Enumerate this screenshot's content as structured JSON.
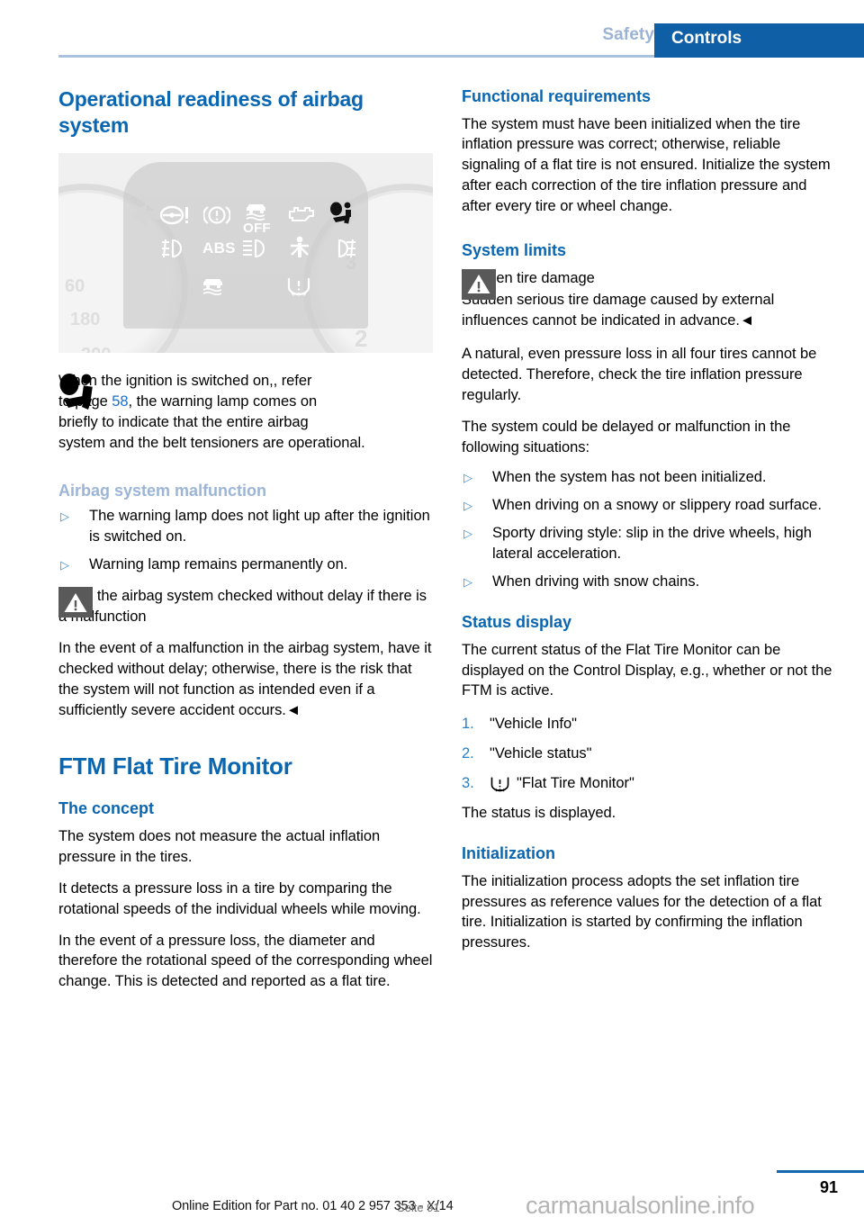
{
  "header": {
    "tab_inactive": "Safety",
    "tab_active": "Controls",
    "accent_blue": "#0f5fa6",
    "muted_blue": "#9bb3d4"
  },
  "figure": {
    "name": "instrument-cluster-warning-lamps",
    "gauge_numbers": [
      "60",
      "180",
      "200",
      "2",
      "3"
    ],
    "tell_tales": [
      "steering-warning-icon",
      "brake-warning-icon",
      "dsc-off-icon",
      "check-engine-icon",
      "airbag-warning-icon",
      "fog-lamp-icon",
      "abs-icon",
      "low-beam-icon",
      "seatbelt-icon",
      "high-beam-icon",
      "dsc-icon",
      "tire-pressure-icon"
    ],
    "dsc_off_label": "OFF",
    "abs_label": "ABS"
  },
  "left_column": {
    "title": "Operational readiness of airbag system",
    "hint": {
      "icon": "airbag-person-icon",
      "line1": "When the ignition is switched on,, refer",
      "line2_pre": "to page ",
      "page_ref": "58",
      "line2_post": ", the warning lamp comes on",
      "line3": "briefly to indicate that the entire airbag",
      "line4": "system and the belt tensioners are operational."
    },
    "malfunction_heading": "Airbag system malfunction",
    "malfunction_bullets": [
      "The warning lamp does not light up after the ignition is switched on.",
      "Warning lamp remains permanently on."
    ],
    "warning": {
      "icon": "warning-triangle-icon",
      "text": "Have the airbag system checked without delay if there is a malfunction",
      "body": "In the event of a malfunction in the airbag system, have it checked without delay; otherwise, there is the risk that the system will not function as intended even if a sufficiently severe accident occurs.◄"
    },
    "ftm_title": "FTM Flat Tire Monitor",
    "concept_heading": "The concept",
    "concept_paragraphs": [
      "The system does not measure the actual inflation pressure in the tires.",
      "It detects a pressure loss in a tire by comparing the rotational speeds of the individual wheels while moving.",
      "In the event of a pressure loss, the diameter and therefore the rotational speed of the corresponding wheel change. This is detected and reported as a flat tire."
    ]
  },
  "right_column": {
    "functional_heading": "Functional requirements",
    "functional_body": "The system must have been initialized when the tire inflation pressure was correct; otherwise, reliable signaling of a flat tire is not ensured. Initialize the system after each correction of the tire inflation pressure and after every tire or wheel change.",
    "system_limits_heading": "System limits",
    "system_limits_warning": {
      "icon": "warning-triangle-icon",
      "title": "Sudden tire damage",
      "body": "Sudden serious tire damage caused by external influences cannot be indicated in advance.◄"
    },
    "limits_paragraphs": [
      "A natural, even pressure loss in all four tires cannot be detected. Therefore, check the tire inflation pressure regularly.",
      "The system could be delayed or malfunction in the following situations:"
    ],
    "limits_bullets": [
      "When the system has not been initialized.",
      "When driving on a snowy or slippery road surface.",
      "Sporty driving style: slip in the drive wheels, high lateral acceleration.",
      "When driving with snow chains."
    ],
    "status_heading": "Status display",
    "status_body": "The current status of the Flat Tire Monitor can be displayed on the Control Display, e.g., whether or not the FTM is active.",
    "status_steps": [
      {
        "num": "1.",
        "label": "\"Vehicle Info\"",
        "icon": ""
      },
      {
        "num": "2.",
        "label": "\"Vehicle status\"",
        "icon": ""
      },
      {
        "num": "3.",
        "label": "\"Flat Tire Monitor\"",
        "icon": "tire-pressure-icon"
      }
    ],
    "status_footer": "The status is displayed.",
    "init_heading": "Initialization",
    "init_body": "The initialization process adopts the set inflation tire pressures as reference values for the detection of a flat tire. Initialization is started by confirming the inflation pressures."
  },
  "footer": {
    "page_number": "91",
    "edition": "Online Edition for Part no. 01 40 2 957 353 - X/14",
    "seite": "Seite 91",
    "watermark": "carmanualsonline.info"
  }
}
